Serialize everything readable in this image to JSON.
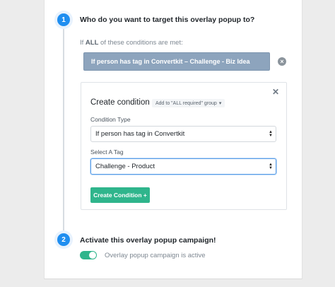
{
  "steps": [
    {
      "number": "1",
      "title": "Who do you want to target this overlay popup to?"
    },
    {
      "number": "2",
      "title": "Activate this overlay popup campaign!"
    }
  ],
  "conditions": {
    "intro_prefix": "If ",
    "intro_bold": "ALL",
    "intro_suffix": " of these conditions are met:",
    "existing_condition": "If person has tag in Convertkit – Challenge - Biz Idea",
    "remove_icon": "×"
  },
  "create_panel": {
    "close_icon": "✕",
    "title": "Create condition",
    "group_dropdown": "Add to \"ALL required\" group",
    "group_caret": "▾",
    "condition_type_label": "Condition Type",
    "condition_type_value": "If person has tag in Convertkit",
    "tag_label": "Select A Tag",
    "tag_value": "Challenge - Product",
    "submit_label": "Create Condition +"
  },
  "activation": {
    "toggle_on": true,
    "status_label": "Overlay popup campaign is active"
  },
  "colors": {
    "accent_blue": "#1f8ef0",
    "accent_green": "#2fb58c",
    "chip_bg": "#8da4bd"
  }
}
